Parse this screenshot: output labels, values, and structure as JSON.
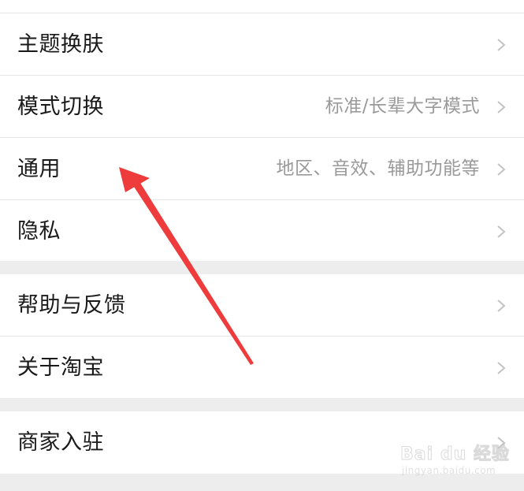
{
  "settings_group_1": {
    "items": [
      {
        "label": "主题换肤",
        "value": ""
      },
      {
        "label": "模式切换",
        "value": "标准/长辈大字模式"
      },
      {
        "label": "通用",
        "value": "地区、音效、辅助功能等"
      },
      {
        "label": "隐私",
        "value": ""
      }
    ]
  },
  "settings_group_2": {
    "items": [
      {
        "label": "帮助与反馈",
        "value": ""
      },
      {
        "label": "关于淘宝",
        "value": ""
      }
    ]
  },
  "settings_group_3": {
    "items": [
      {
        "label": "商家入驻",
        "value": ""
      }
    ]
  },
  "annotation": {
    "arrow_color": "#ee3b3b",
    "target": "通用"
  },
  "watermark": {
    "logo_text": "Bai du 经验",
    "url_text": "jingyan.baidu.com"
  },
  "colors": {
    "background": "#ededed",
    "card": "#ffffff",
    "label": "#1a1a1a",
    "value": "#9a9a9a",
    "chevron": "#c4c4c4"
  },
  "icons": {
    "row_chevron": "chevron-right-icon"
  }
}
